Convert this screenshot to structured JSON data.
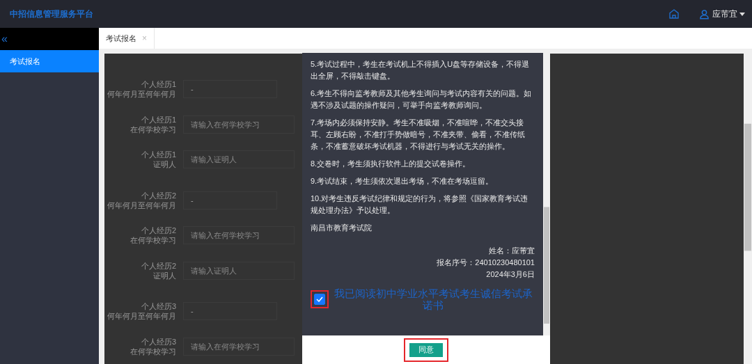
{
  "header": {
    "title": "中招信息管理服务平台",
    "user_name": "应芾宜"
  },
  "sidebar": {
    "collapse": "«",
    "items": [
      {
        "label": "考试报名",
        "selected": true
      }
    ]
  },
  "tabs": [
    {
      "label": "考试报名",
      "selected": true,
      "close": "×"
    }
  ],
  "form": {
    "rows": [
      {
        "label": [
          "个人经历1",
          "何年何月至何年何月"
        ],
        "kind": "date",
        "value": "-"
      },
      {
        "label": [
          "个人经历1",
          "在何学校学习"
        ],
        "kind": "text",
        "placeholder": "请输入在何学校学习"
      },
      {
        "label": [
          "个人经历1",
          "证明人"
        ],
        "kind": "text",
        "placeholder": "请输入证明人"
      },
      {
        "label": [
          "个人经历2",
          "何年何月至何年何月"
        ],
        "kind": "date",
        "value": "-"
      },
      {
        "label": [
          "个人经历2",
          "在何学校学习"
        ],
        "kind": "text",
        "placeholder": "请输入在何学校学习"
      },
      {
        "label": [
          "个人经历2",
          "证明人"
        ],
        "kind": "text",
        "placeholder": "请输入证明人"
      },
      {
        "label": [
          "个人经历3",
          "何年何月至何年何月"
        ],
        "kind": "date",
        "value": "-"
      },
      {
        "label": [
          "个人经历3",
          "在何学校学习"
        ],
        "kind": "text",
        "placeholder": "请输入在何学校学习"
      }
    ]
  },
  "modal": {
    "paragraphs": [
      "5.考试过程中，考生在考试机上不得插入U盘等存储设备，不得退出全屏，不得敲击键盘。",
      "6.考生不得向监考教师及其他考生询问与考试内容有关的问题。如遇不涉及试题的操作疑问，可举手向监考教师询问。",
      "7.考场内必须保持安静。考生不准吸烟，不准喧哗，不准交头接耳、左顾右盼，不准打手势做暗号，不准夹带、偷看，不准传纸条，不准蓄意破坏考试机器，不得进行与考试无关的操作。",
      "8.交卷时，考生须执行软件上的提交试卷操作。",
      "9.考试结束，考生须依次退出考场，不准在考场逗留。",
      "10.对考生违反考试纪律和规定的行为，将参照《国家教育考试违规处理办法》予以处理。",
      "南昌市教育考试院"
    ],
    "signature": [
      "姓名：应芾宜",
      "报名序号：24010230480101",
      "2024年3月6日"
    ],
    "agreement": {
      "label": "我已阅读初中学业水平考试考生诚信考试承诺书",
      "checked": true
    },
    "button": "同意"
  }
}
